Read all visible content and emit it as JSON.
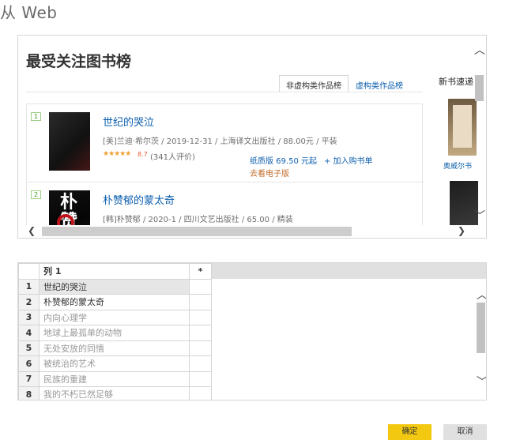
{
  "window": {
    "title": "从 Web"
  },
  "web": {
    "heading": "最受关注图书榜",
    "tabs": [
      "非虚构类作品榜",
      "虚构类作品榜"
    ],
    "new_books": "新书速递",
    "books": [
      {
        "rank": "1",
        "title": "世纪的哭泣",
        "meta": "[美]兰迪·希尔茨 / 2019-12-31 / 上海译文出版社 / 88.00元 / 平装",
        "stars": "★★★★★",
        "score": "8.7",
        "reviews": "(341人评价)",
        "price": "纸质版 69.50 元起",
        "cart": "+ 加入购书单",
        "ebook": "去看电子版"
      },
      {
        "rank": "2",
        "title": "朴赞郁的蒙太奇",
        "meta": "[韩]朴赞郁 / 2020-1 / 四川文艺出版社 / 65.00 / 精装",
        "cover_text": "朴赞"
      }
    ],
    "side_book": "奥威尔书"
  },
  "grid": {
    "header": [
      "",
      "列 1",
      "*"
    ],
    "rows": [
      {
        "n": "1",
        "v": "世纪的哭泣"
      },
      {
        "n": "2",
        "v": "朴赞郁的蒙太奇"
      },
      {
        "n": "3",
        "v": "内向心理学"
      },
      {
        "n": "4",
        "v": "地球上最孤单的动物"
      },
      {
        "n": "5",
        "v": "无处安放的同情"
      },
      {
        "n": "6",
        "v": "被统治的艺术"
      },
      {
        "n": "7",
        "v": "民族的重建"
      },
      {
        "n": "8",
        "v": "我的不朽已然足够"
      }
    ]
  },
  "buttons": {
    "ok": "确定",
    "cancel": "取消"
  }
}
